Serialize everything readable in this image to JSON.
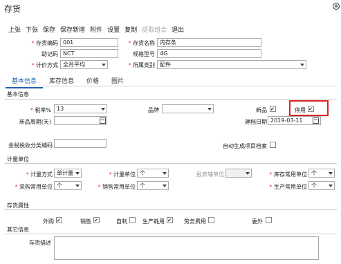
{
  "window": {
    "title": "存货"
  },
  "toolbar": {
    "prev": "上张",
    "next": "下张",
    "save": "保存",
    "save_new": "保存新增",
    "attach": "附件",
    "settings": "设置",
    "copy": "复制",
    "extract": "提取组合",
    "exit": "退出"
  },
  "header_form": {
    "code_label": "存货编码",
    "code_value": "001",
    "name_label": "存货名称",
    "name_value": "内存条",
    "mnemonic_label": "助记码",
    "mnemonic_value": "NCT",
    "spec_label": "规格型号",
    "spec_value": "4G",
    "valuation_label": "计价方式",
    "valuation_value": "全月平均",
    "category_label": "所属类别",
    "category_value": "配件"
  },
  "tabs": [
    "基本信息",
    "库存信息",
    "价格",
    "图片"
  ],
  "basic": {
    "section_title": "基本信息",
    "tax_label": "税率%",
    "tax_value": "13",
    "brand_label": "品牌",
    "brand_value": "",
    "new_label": "新品",
    "new_checked": true,
    "disabled_label": "停用",
    "disabled_checked": true,
    "new_cycle_label": "新品周期(天)",
    "new_cycle_value": "",
    "created_label": "建档日期",
    "created_value": "2019-03-11",
    "tax_code_label": "金税税收分类编码",
    "tax_code_value": "",
    "auto_archive_label": "自动生成项目档案",
    "auto_archive_checked": false
  },
  "units": {
    "section_title": "计量单位",
    "unit_mode_label": "计量方式",
    "unit_mode_value": "单计量",
    "unit_label": "计量单位",
    "unit_value": "个",
    "report_unit_label": "报表辅单位",
    "report_unit_value": "",
    "stock_unit_label": "库存常用单位",
    "stock_unit_value": "个",
    "purchase_unit_label": "采购常用单位",
    "purchase_unit_value": "个",
    "sales_unit_label": "销售常用单位",
    "sales_unit_value": "个",
    "production_unit_label": "生产常用单位",
    "production_unit_value": "个"
  },
  "attributes": {
    "section_title": "存货属性",
    "items": [
      {
        "label": "外购",
        "checked": true
      },
      {
        "label": "销售",
        "checked": true
      },
      {
        "label": "自制",
        "checked": false
      },
      {
        "label": "生产耗用",
        "checked": true
      },
      {
        "label": "劳务费用",
        "checked": false
      },
      {
        "label": "委外",
        "checked": false
      }
    ]
  },
  "other": {
    "section_title": "其它信息",
    "desc_label": "存货描述",
    "desc_value": ""
  }
}
